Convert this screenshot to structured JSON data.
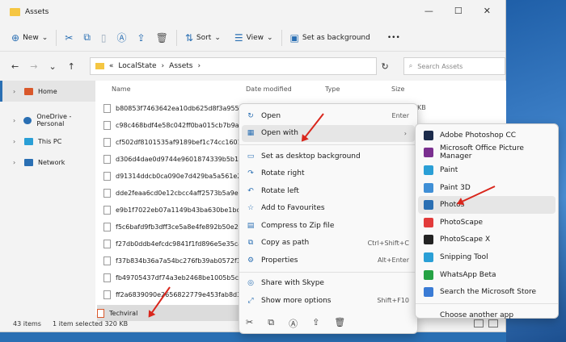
{
  "window": {
    "title": "Assets",
    "controls": [
      "—",
      "☐",
      "✕"
    ]
  },
  "toolbar": {
    "new_label": "New",
    "sort_label": "Sort",
    "view_label": "View",
    "set_background_label": "Set as background",
    "more": "•••"
  },
  "address": {
    "prefix": "«",
    "path1": "LocalState",
    "path2": "Assets",
    "search_placeholder": "Search Assets"
  },
  "sidebar": {
    "items": [
      {
        "label": "Home",
        "color": "#d9582b"
      },
      {
        "label": "OneDrive - Personal",
        "color": "#2a6fb3"
      },
      {
        "label": "This PC",
        "color": "#2a9fd6"
      },
      {
        "label": "Network",
        "color": "#2a6fb3"
      }
    ]
  },
  "columns": {
    "name": "Name",
    "date": "Date modified",
    "type": "Type",
    "size": "Size"
  },
  "files": [
    "b80853f7463642ea10db625d8f3a9559e089...",
    "c98c468bdf4e58c042ff0ba015cb7b9a5797...",
    "cf502df8101535af9189bef1c74cc1601049...",
    "d306d4dae0d9744e9601874339b5b108654...",
    "d91314ddcb0ca090e7d429ba5a561e25b5c...",
    "dde2feaa6cd0e12cbcc4aff2573b5a9e8d52...",
    "e9b1f7022eb07a1149b43ba630be1bcf262...",
    "f5c6bafd9fb3dff3ce5a8e4fe892b50e2077e...",
    "f27db0ddb4efcdc9841f1fd896e5e35cab17...",
    "f37b834b36a7a54bc276fb39ab0572f15250...",
    "fb49705437df74a3eb2468be1005b5cc9712...",
    "ff2a6839090e2656822779e453fab8d3389..."
  ],
  "selected_file": "Techviral",
  "size_unit": "KB",
  "status": {
    "count": "43 items",
    "selected": "1 item selected  320 KB"
  },
  "context_menu": {
    "items": [
      {
        "icon": "↻",
        "label": "Open",
        "shortcut": "Enter"
      },
      {
        "icon": "▦",
        "label": "Open with",
        "shortcut": "›"
      },
      {
        "icon": "▭",
        "label": "Set as desktop background",
        "shortcut": ""
      },
      {
        "icon": "↷",
        "label": "Rotate right",
        "shortcut": ""
      },
      {
        "icon": "↶",
        "label": "Rotate left",
        "shortcut": ""
      },
      {
        "icon": "☆",
        "label": "Add to Favourites",
        "shortcut": ""
      },
      {
        "icon": "▤",
        "label": "Compress to Zip file",
        "shortcut": ""
      },
      {
        "icon": "⧉",
        "label": "Copy as path",
        "shortcut": "Ctrl+Shift+C"
      },
      {
        "icon": "⚙",
        "label": "Properties",
        "shortcut": "Alt+Enter"
      },
      {
        "icon": "◎",
        "label": "Share with Skype",
        "shortcut": ""
      },
      {
        "icon": "⤢",
        "label": "Show more options",
        "shortcut": "Shift+F10"
      }
    ],
    "bottom_icons": [
      "✂",
      "⧉",
      "Ⓐ",
      "⇪",
      "🗑"
    ]
  },
  "open_with_menu": {
    "items": [
      {
        "label": "Adobe Photoshop CC",
        "color": "#1b2b4b"
      },
      {
        "label": "Microsoft Office Picture Manager",
        "color": "#7a2f8f"
      },
      {
        "label": "Paint",
        "color": "#2a9fd6"
      },
      {
        "label": "Paint 3D",
        "color": "#3f8fd6"
      },
      {
        "label": "Photos",
        "color": "#2a6fb3"
      },
      {
        "label": "PhotoScape",
        "color": "#e23b3b"
      },
      {
        "label": "PhotoScape X",
        "color": "#222222"
      },
      {
        "label": "Snipping Tool",
        "color": "#2a9fd6"
      },
      {
        "label": "WhatsApp Beta",
        "color": "#25a244"
      },
      {
        "label": "Search the Microsoft Store",
        "color": "#3a7bd5"
      },
      {
        "label": "Choose another app",
        "color": ""
      }
    ]
  },
  "colors": {
    "accent": "#2a6fb3",
    "arrow": "#d9261c"
  }
}
